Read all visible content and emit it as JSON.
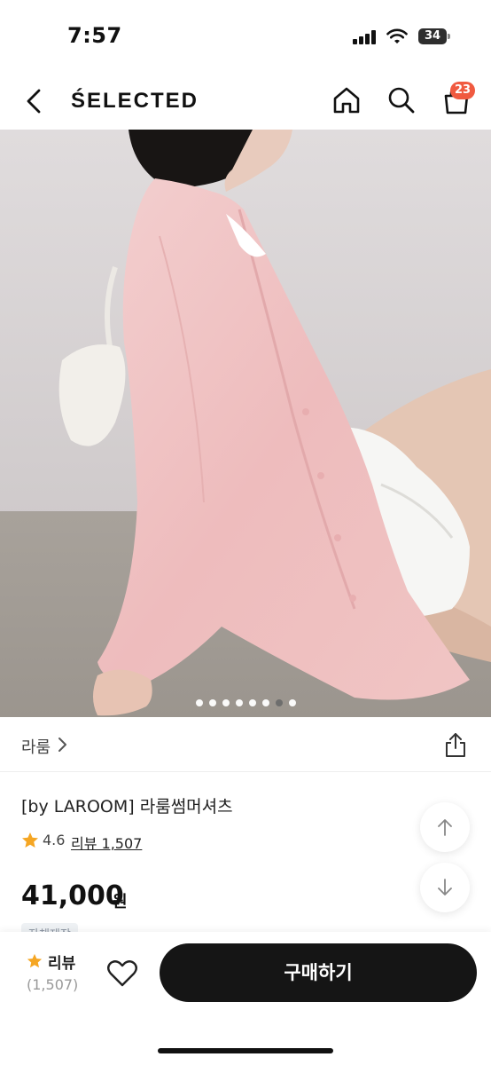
{
  "status": {
    "time": "7:57",
    "battery": "34"
  },
  "header": {
    "brand": "ŚELECTED",
    "cart_count": "23"
  },
  "carousel": {
    "total": 8,
    "active_index": 6
  },
  "seller": {
    "name": "라룸"
  },
  "product": {
    "name": "[by LAROOM] 라룸썸머셔츠",
    "rating": "4.6",
    "review_link": "리뷰 1,507",
    "price": "41,000",
    "price_unit": "원",
    "tag": "자체제작"
  },
  "bottom_bar": {
    "review_label": "리뷰",
    "review_count": "(1,507)",
    "buy_label": "구매하기"
  },
  "colors": {
    "accent": "#f05a40",
    "star": "#f5a623",
    "button": "#151515"
  }
}
